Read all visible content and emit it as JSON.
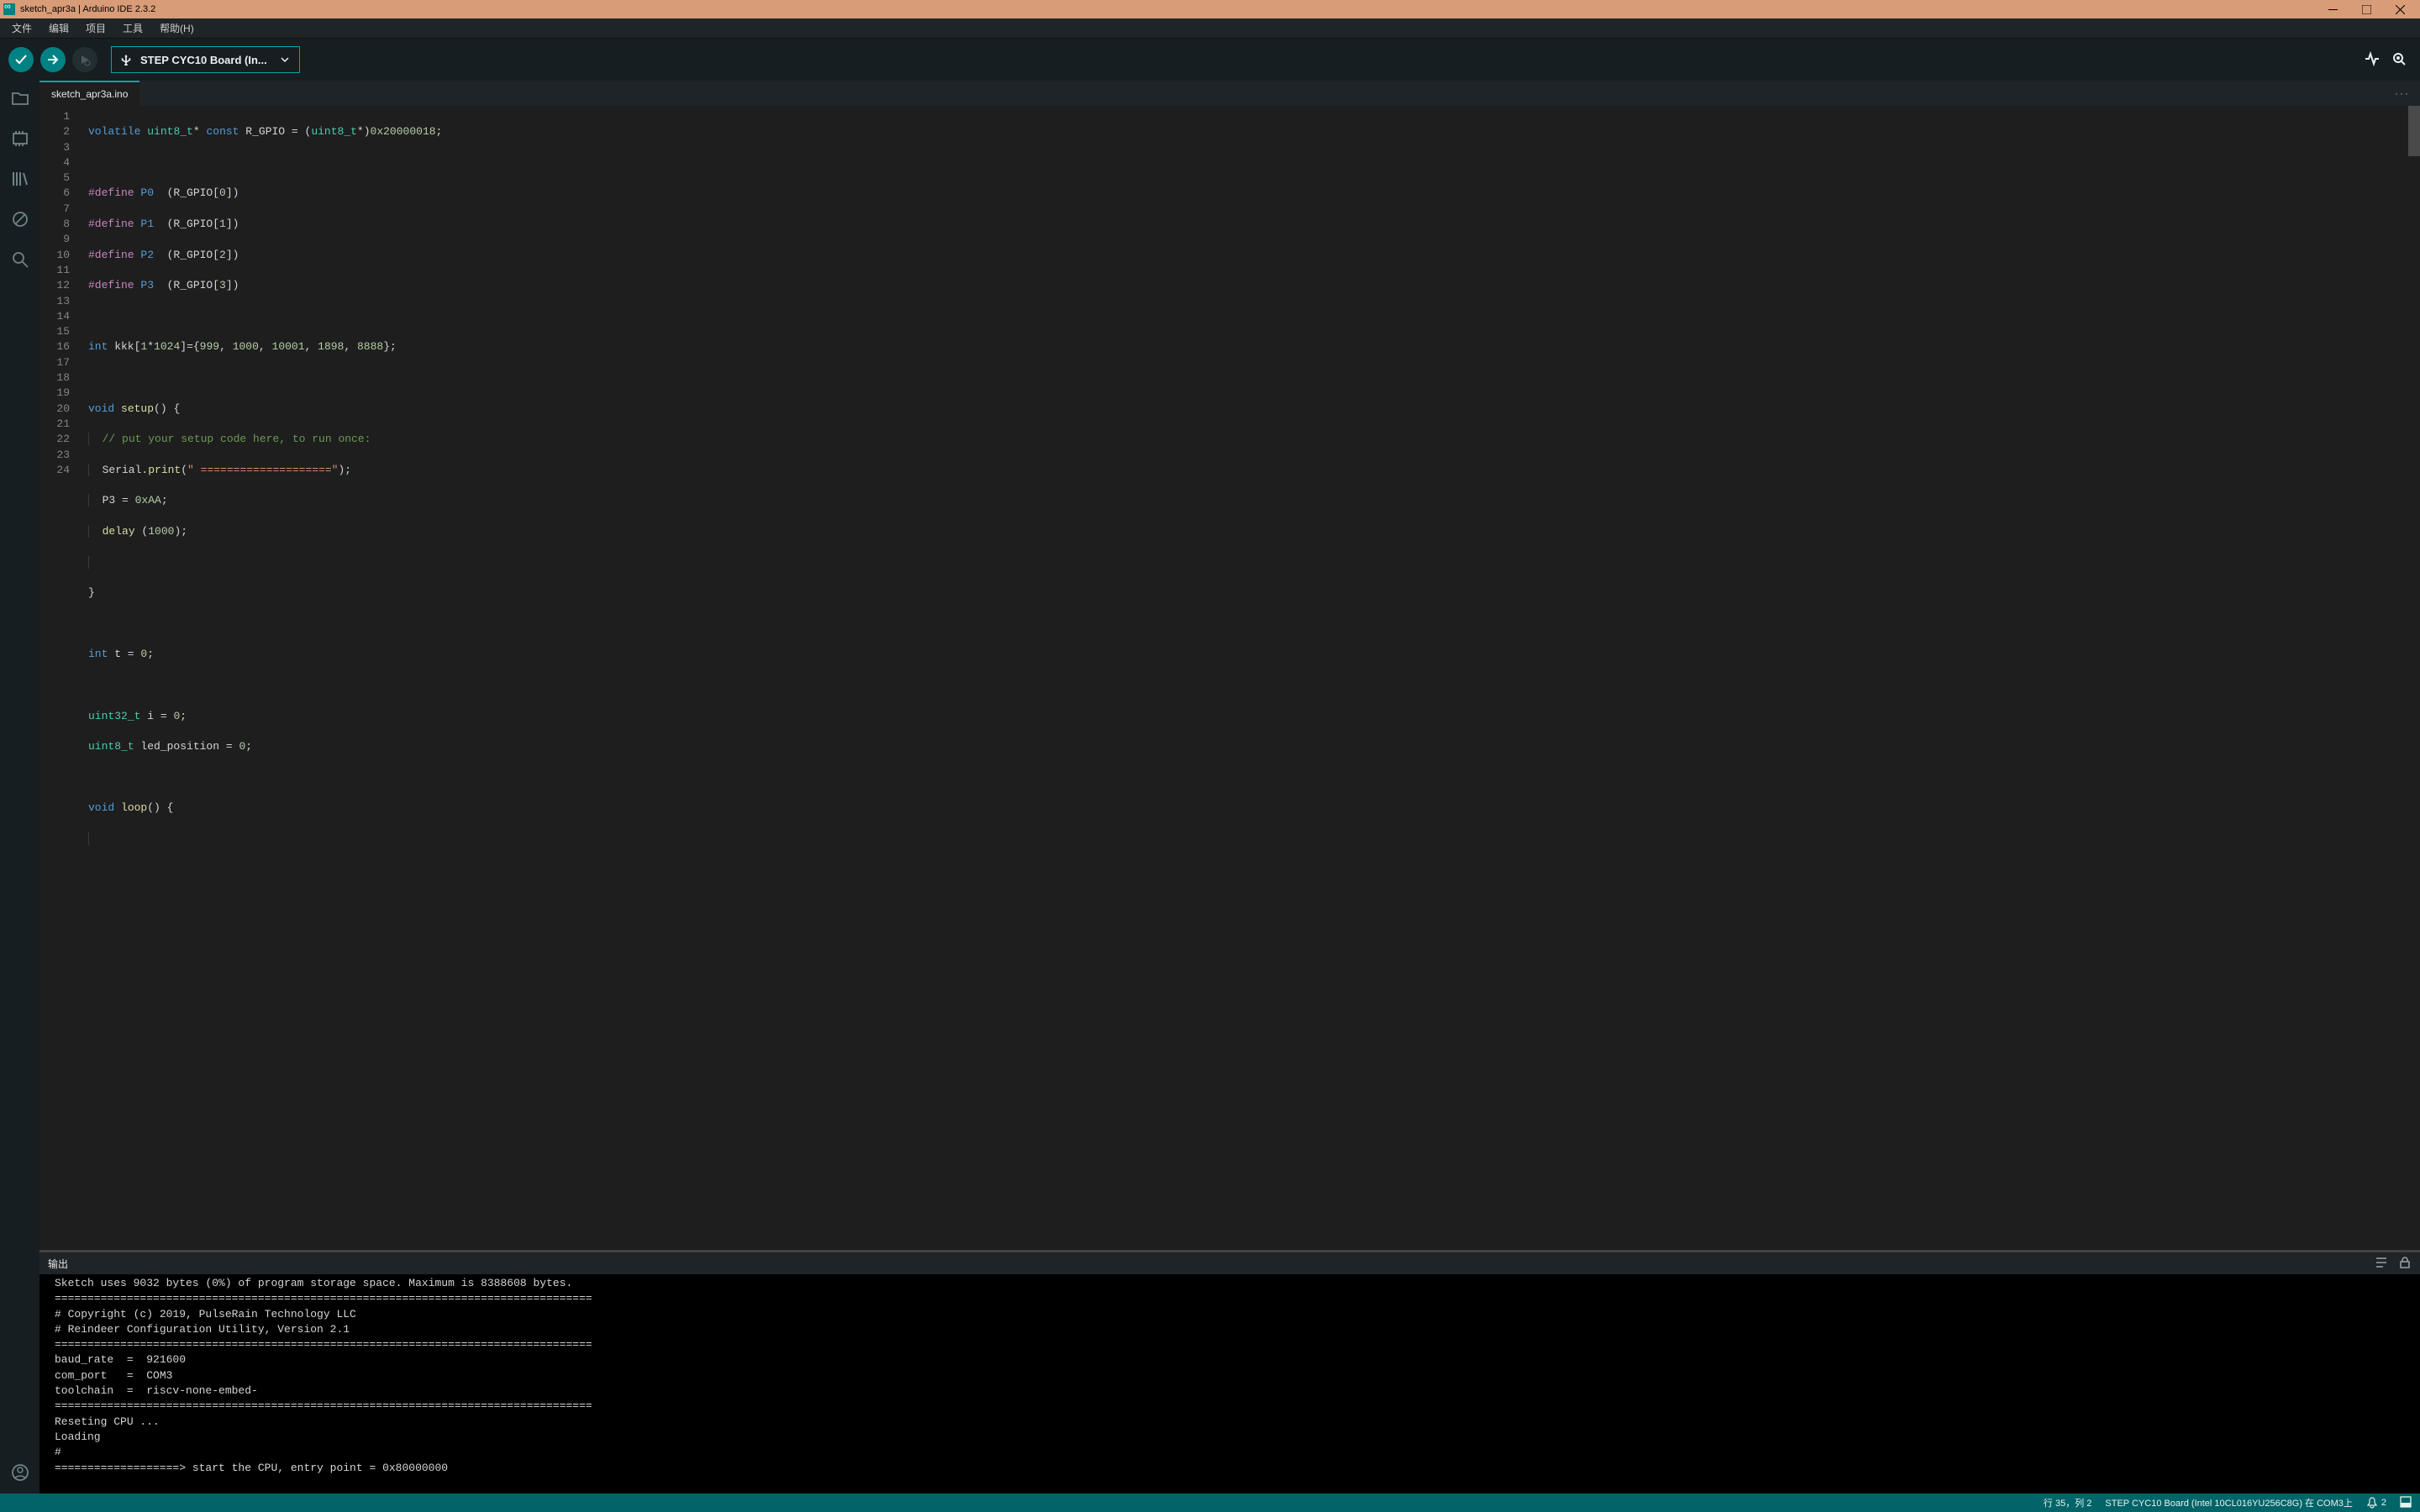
{
  "window": {
    "title": "sketch_apr3a | Arduino IDE 2.3.2"
  },
  "menus": [
    "文件",
    "编辑",
    "项目",
    "工具",
    "帮助(H)"
  ],
  "toolbar": {
    "board_label": "STEP CYC10 Board (In..."
  },
  "tab": {
    "filename": "sketch_apr3a.ino"
  },
  "code": {
    "lines": 24,
    "l1_a": "volatile",
    "l1_b": "uint8_t",
    "l1_c": "*",
    "l1_d": "const",
    "l1_e": " R_GPIO = (",
    "l1_f": "uint8_t",
    "l1_g": "*)",
    "l1_h": "0x20000018",
    "l1_i": ";",
    "l3_a": "#define",
    "l3_b": " P0",
    "l3_c": "  (R_GPIO[",
    "l3_d": "0",
    "l3_e": "])",
    "l4_a": "#define",
    "l4_b": " P1",
    "l4_c": "  (R_GPIO[",
    "l4_d": "1",
    "l4_e": "])",
    "l5_a": "#define",
    "l5_b": " P2",
    "l5_c": "  (R_GPIO[",
    "l5_d": "2",
    "l5_e": "])",
    "l6_a": "#define",
    "l6_b": " P3",
    "l6_c": "  (R_GPIO[",
    "l6_d": "3",
    "l6_e": "])",
    "l8_a": "int",
    "l8_b": " kkk[",
    "l8_c": "1",
    "l8_d": "*",
    "l8_e": "1024",
    "l8_f": "]={",
    "l8_g": "999",
    "l8_h": ", ",
    "l8_i": "1000",
    "l8_j": ", ",
    "l8_k": "10001",
    "l8_l": ", ",
    "l8_m": "1898",
    "l8_n": ", ",
    "l8_o": "8888",
    "l8_p": "};",
    "l10_a": "void",
    "l10_b": "setup",
    "l10_c": "() {",
    "l11_a": "  ",
    "l11_b": "// put your setup code here, to run once:",
    "l12_a": "  Serial.",
    "l12_b": "print",
    "l12_c": "(",
    "l12_d": "\" ====================\"",
    "l12_e": ");",
    "l13_a": "  P3 = ",
    "l13_b": "0xAA",
    "l13_c": ";",
    "l14_a": "  ",
    "l14_b": "delay",
    "l14_c": " (",
    "l14_d": "1000",
    "l14_e": ");",
    "l16_a": "}",
    "l18_a": "int",
    "l18_b": " t = ",
    "l18_c": "0",
    "l18_d": ";",
    "l20_a": "uint32_t",
    "l20_b": " i = ",
    "l20_c": "0",
    "l20_d": ";",
    "l21_a": "uint8_t",
    "l21_b": " led_position = ",
    "l21_c": "0",
    "l21_d": ";",
    "l23_a": "void",
    "l23_b": "loop",
    "l23_c": "() {"
  },
  "output": {
    "header": "输出",
    "l1": "Sketch uses 9032 bytes (0%) of program storage space. Maximum is 8388608 bytes.",
    "l2": "==================================================================================",
    "l3": "# Copyright (c) 2019, PulseRain Technology LLC",
    "l4": "# Reindeer Configuration Utility, Version 2.1",
    "l5": "==================================================================================",
    "l6": "baud_rate  =  921600",
    "l7": "com_port   =  COM3",
    "l8": "toolchain  =  riscv-none-embed-",
    "l9": "==================================================================================",
    "l10": "Reseting CPU ...",
    "l11": "Loading",
    "l12": "#",
    "l13": "===================> start the CPU, entry point = 0x80000000"
  },
  "status": {
    "pos": "行 35，列 2",
    "board": "STEP CYC10 Board (Intel 10CL016YU256C8G) 在 COM3上",
    "notif": "2"
  }
}
